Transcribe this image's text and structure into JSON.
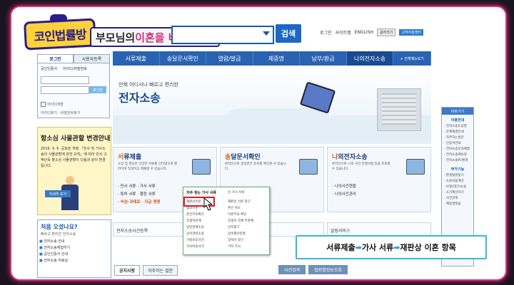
{
  "show": {
    "logo_text": "코인법률방",
    "subtitle_pre": "부모님의 ",
    "subtitle_highlight": "이혼을 바랍니다?"
  },
  "header": {
    "search_button": "검색",
    "top_links": [
      "로그인",
      "사이트맵",
      "ENGLISH"
    ],
    "small_button": "글자크기",
    "blue_button": "고객지원센터"
  },
  "nav": {
    "items": [
      "서류제출",
      "송달문서확인",
      "열람/발급",
      "제증명",
      "납부/환급",
      "나의전자소송"
    ],
    "more": "+ 전체메뉴보기"
  },
  "login": {
    "tab_login": "로그인",
    "tab_register": "사용자등록",
    "row_tabs": [
      "공인인증서",
      "아이디/비밀번호"
    ],
    "login_button": "로그인",
    "save_id": "아이디저장",
    "links": "아이디찾기 · 비밀번호찾기"
  },
  "notice": {
    "title": "항소심 사물관할 변경안내",
    "text": "2016. 9. 6. 공포된 개정 「민사 및 가사소송의 사물관할에 관한 규칙」에 따라 민사 고액단독 항소심 사물관할이 다음과 같이 변경됩니다.",
    "button": "자세히 보기"
  },
  "help": {
    "title": "처음 오셨나요?",
    "sub": "빠르고 편리한 전자소송",
    "items": [
      "전자소송 안내",
      "전자소송체험하기",
      "공인인증서 안내",
      "전자소송 자료실"
    ]
  },
  "hero": {
    "line1": "언제 어디서나 빠르고 편리한",
    "line2": "전자소송"
  },
  "cards": [
    {
      "title_first": "서",
      "title_rest": "류제출",
      "desc": "소장 및 필요한 다양한 서류를 인터넷으로 편리하게 작성하고 제출할 수 있습니다.",
      "list": [
        "· 민사 서류  · 가사 서류",
        "· 특허 서류  · 행정 서류",
        "· 비송·과태료  · 지급 명령"
      ]
    },
    {
      "title_first": "송",
      "title_rest": "달문서확인",
      "desc": "온라인으로 송달받은 문서를 확인할 수 있습니다.",
      "list": []
    },
    {
      "title_first": "나",
      "title_rest": "의전자소송",
      "desc": "온라인으로 나의 사건 진행사항 등을 조회할 수 있습니다.",
      "list": [
        "· 나의사건현황",
        "· 나의사건관리"
      ]
    }
  ],
  "bar2": [
    "전자소송사건등록",
    "",
    "알림서비스"
  ],
  "bar3": {
    "tabs": [
      "공지사항",
      "자주하는 질문"
    ],
    "right": [
      "사건검색",
      "법원별정보조회"
    ]
  },
  "rside": {
    "title": "바로가기",
    "section1": "이용안내",
    "items1": [
      "전자소송도움말",
      "문제해결안내",
      "자주하는질문",
      "인증서안내",
      "전자소송모의체험",
      "전자소송메뉴얼",
      "전자소송PC환경"
    ],
    "section2": "부가기능",
    "items2": [
      "판결법원찾기",
      "소송비용계산",
      "보정(대기)소송",
      "소가계산하기",
      "사건검색",
      "제증명발급"
    ]
  },
  "popup": {
    "header": "자주 찾는 가사 서류",
    "header2": "민·가사 서류",
    "col1": [
      "재판상이혼",
      "협의이혼",
      "혼인무효확인",
      "친생자관계",
      "입양관계소송",
      "상속관련소송",
      "가정보호사건",
      "가사비송사건"
    ],
    "col2": [
      "재판상 이혼 청구",
      "혼인 취소",
      "이혼무효 확인",
      "친생자 관계 부존재",
      "인지청구",
      "상속재산분할",
      "양육비 청구",
      "기타 가사"
    ]
  },
  "caption": {
    "part1": "서류제출",
    "part2": "가사 서류",
    "part3": "재판상 이혼 항목",
    "arrow": "➡"
  },
  "colors": {
    "frame": "#e0307e",
    "nav": "#2a63b3",
    "caption_border": "#36b9d2",
    "highlight": "#e01c2a"
  }
}
